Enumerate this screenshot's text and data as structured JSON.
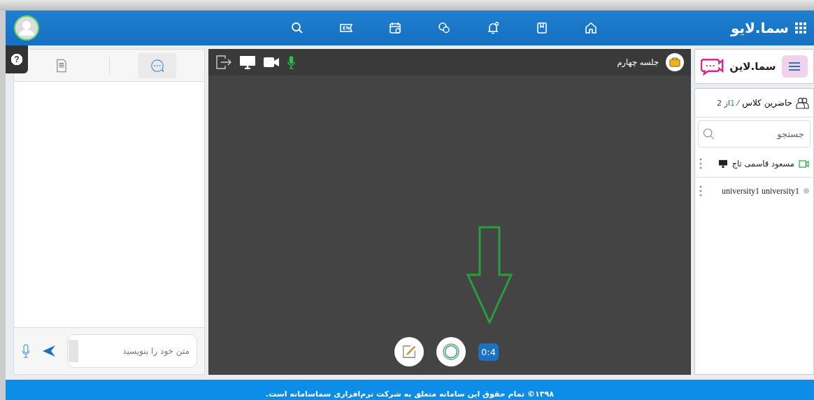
{
  "header": {
    "brand": "سما.لایو"
  },
  "help": {
    "label": "?"
  },
  "sidebar": {
    "logo": "سما.لاین",
    "participants": {
      "title": "حاضرین کلاس",
      "separator": "⁄",
      "online": "1",
      "total": "از 2"
    },
    "search": {
      "placeholder": "جستجو"
    },
    "users": [
      {
        "name": "مسعود قاسمی تاج",
        "kind": "camera",
        "presenting": true
      },
      {
        "name": "university1 university1",
        "kind": "offline",
        "presenting": false
      }
    ]
  },
  "session": {
    "title": "جلسه چهارم",
    "mic_on": true,
    "timer": "0:4"
  },
  "chat": {
    "tabs": [
      {
        "kind": "chat",
        "selected": true
      },
      {
        "kind": "notes",
        "selected": false
      }
    ],
    "placeholder": "متن خود را بنویسید"
  },
  "footer": "۱۳۹۸© تمام حقوق این سامانه متعلق به شرکت نرم‌افزاری سماسامانه است."
}
